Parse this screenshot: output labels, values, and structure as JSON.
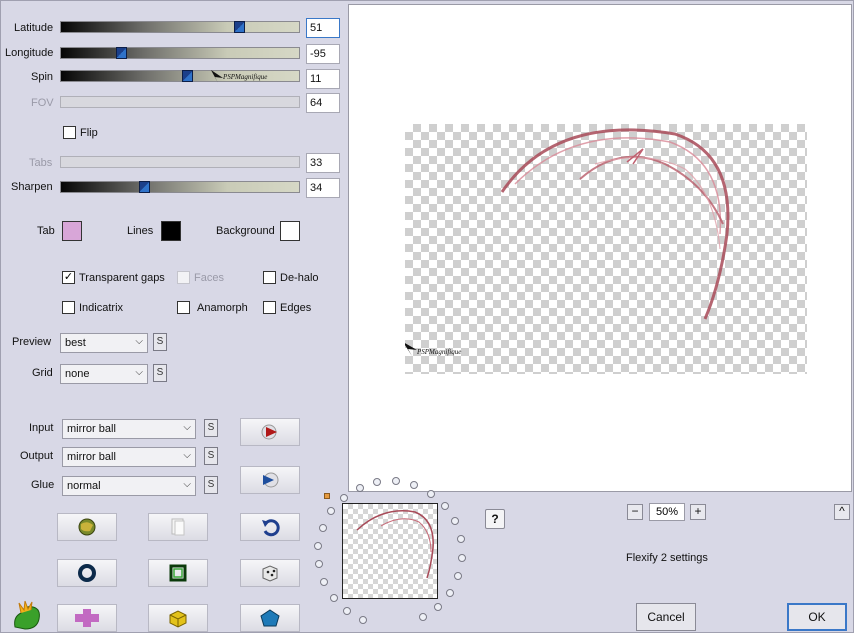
{
  "controls": {
    "latitude": {
      "label": "Latitude",
      "value": "51",
      "fraction": 0.76
    },
    "longitude": {
      "label": "Longitude",
      "value": "-95",
      "fraction": 0.24
    },
    "spin": {
      "label": "Spin",
      "value": "11",
      "fraction": 0.53
    },
    "fov": {
      "label": "FOV",
      "value": "64"
    },
    "tabs": {
      "label": "Tabs",
      "value": "33"
    },
    "sharpen": {
      "label": "Sharpen",
      "value": "34",
      "fraction": 0.34
    },
    "flip_label": "Flip"
  },
  "watermark_text": "PSPMagnifique",
  "colors": {
    "tab_label": "Tab",
    "tab_color": "#d8a6d8",
    "lines_label": "Lines",
    "lines_color": "#000000",
    "background_label": "Background",
    "background_color": "#ffffff"
  },
  "options": {
    "transparent_gaps": "Transparent gaps",
    "faces": "Faces",
    "dehalo": "De-halo",
    "indicatrix": "Indicatrix",
    "anamorph": "Anamorph",
    "edges": "Edges"
  },
  "preview": {
    "label": "Preview",
    "value": "best",
    "s_label": "S"
  },
  "grid": {
    "label": "Grid",
    "value": "none",
    "s_label": "S"
  },
  "projection": {
    "input": {
      "label": "Input",
      "value": "mirror ball"
    },
    "output": {
      "label": "Output",
      "value": "mirror ball"
    },
    "glue": {
      "label": "Glue",
      "value": "normal"
    },
    "s_label": "S"
  },
  "zoom": {
    "minus": "−",
    "value": "50%",
    "plus": "+"
  },
  "settings_title": "Flexify 2 settings",
  "help_label": "?",
  "collapse_label": "^",
  "buttons": {
    "cancel": "Cancel",
    "ok": "OK"
  }
}
